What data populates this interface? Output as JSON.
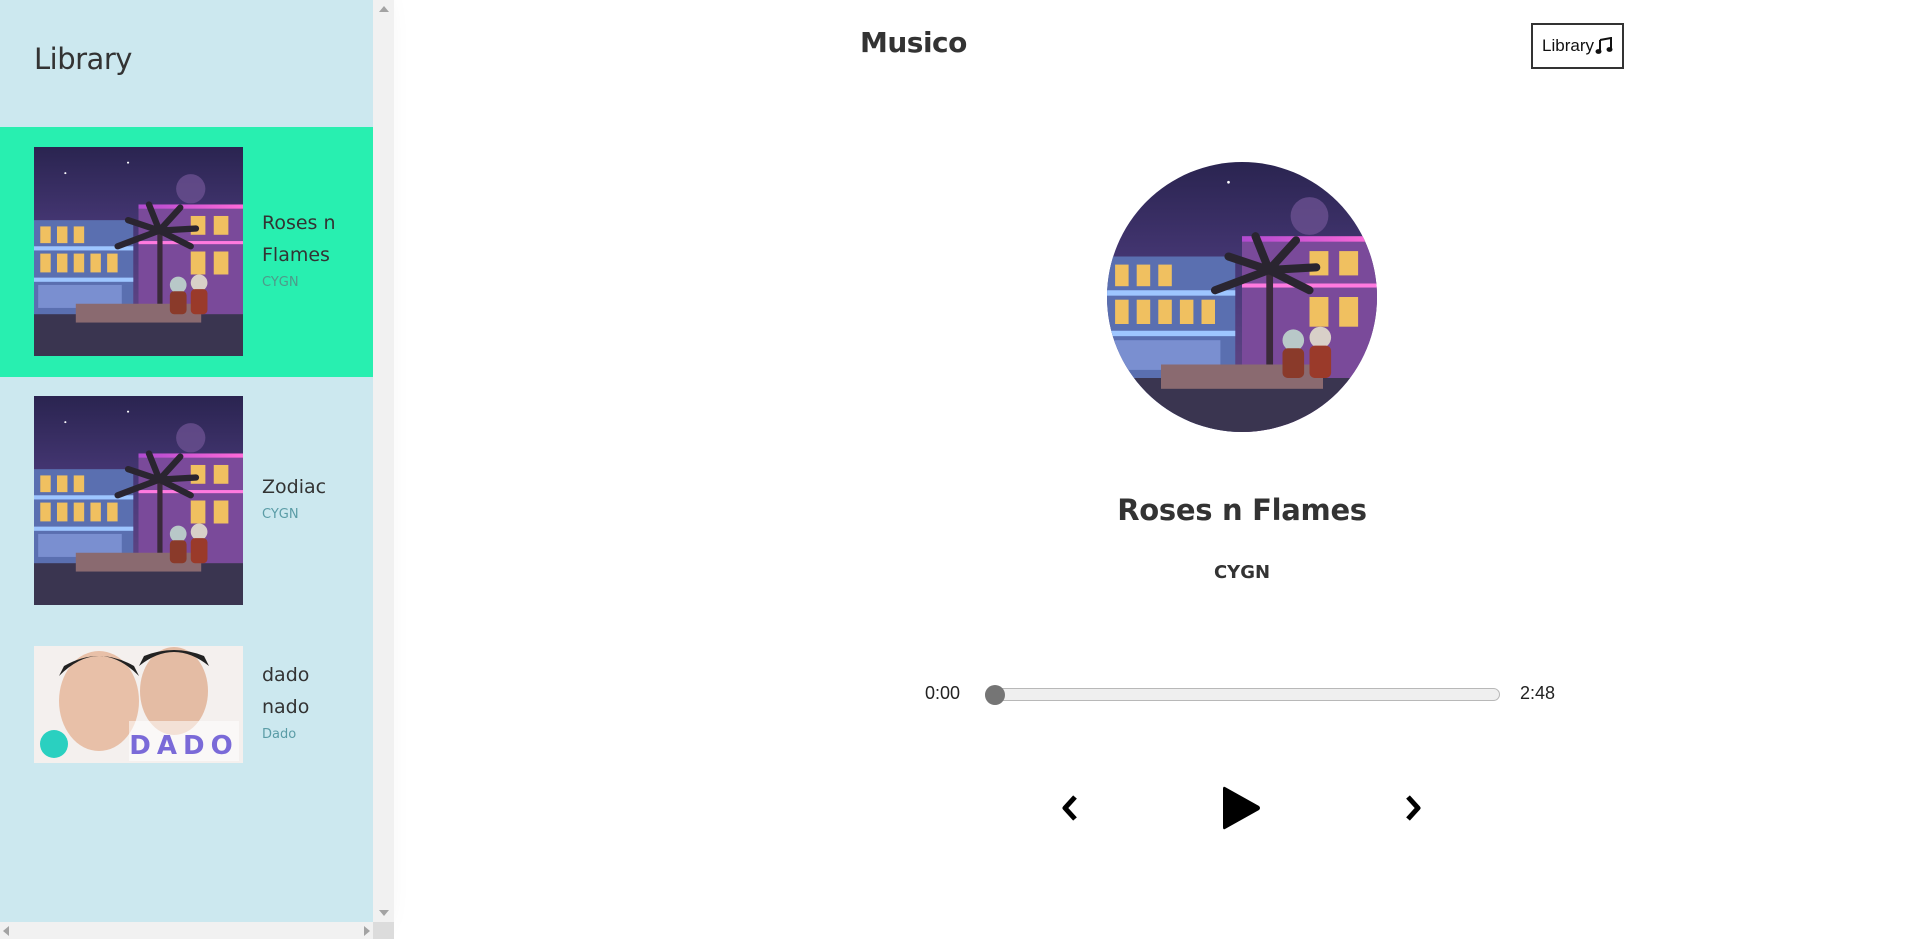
{
  "sidebar": {
    "title": "Library",
    "songs": [
      {
        "name": "Roses n Flames",
        "artist": "CYGN",
        "selected": true,
        "cover": "night-motel-artwork"
      },
      {
        "name": "Zodiac",
        "artist": "CYGN",
        "selected": false,
        "cover": "night-motel-artwork"
      },
      {
        "name": "dado nado",
        "artist": "Dado",
        "selected": false,
        "cover": "dado-duo-photo"
      }
    ],
    "selected_color": "#28efb0",
    "background_color": "#cce8ef"
  },
  "header": {
    "brand": "Musico",
    "library_button_label": "Library",
    "library_button_icon": "music-note-icon"
  },
  "player": {
    "title": "Roses n Flames",
    "artist": "CYGN",
    "current_time": "0:00",
    "duration": "2:48",
    "progress": 0,
    "controls": {
      "prev_icon": "chevron-left-icon",
      "play_icon": "play-icon",
      "next_icon": "chevron-right-icon"
    }
  }
}
